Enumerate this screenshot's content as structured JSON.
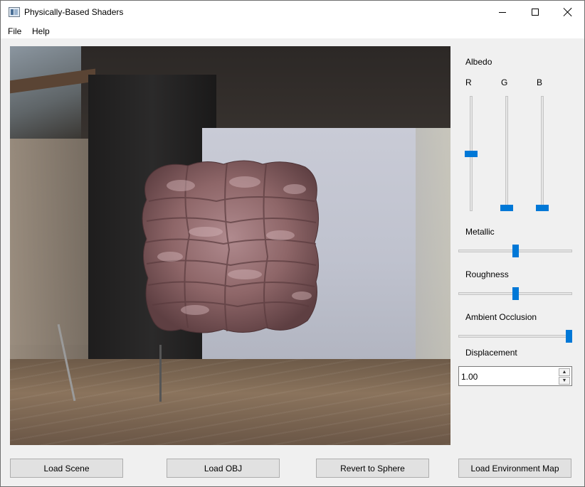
{
  "window": {
    "title": "Physically-Based Shaders"
  },
  "menu": {
    "items": [
      "File",
      "Help"
    ]
  },
  "panel": {
    "albedo": {
      "label": "Albedo",
      "channels": [
        {
          "label": "R",
          "value": 0.5
        },
        {
          "label": "G",
          "value": 0.0
        },
        {
          "label": "B",
          "value": 0.0
        }
      ]
    },
    "metallic": {
      "label": "Metallic",
      "value": 0.5
    },
    "roughness": {
      "label": "Roughness",
      "value": 0.5
    },
    "ambient_occlusion": {
      "label": "Ambient Occlusion",
      "value": 1.0
    },
    "displacement": {
      "label": "Displacement",
      "value": "1.00"
    }
  },
  "buttons": {
    "load_scene": "Load Scene",
    "load_obj": "Load OBJ",
    "revert_sphere": "Revert to Sphere",
    "load_env_map": "Load Environment Map"
  }
}
